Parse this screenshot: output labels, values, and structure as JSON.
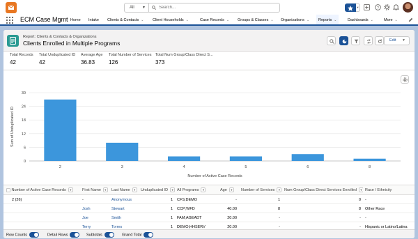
{
  "app": {
    "name": "ECM Case Mgmt",
    "search_scope": "All",
    "search_placeholder": "Search...",
    "nav": [
      {
        "label": "Home",
        "dropdown": false
      },
      {
        "label": "Intake",
        "dropdown": false
      },
      {
        "label": "Clients & Contacts",
        "dropdown": true
      },
      {
        "label": "Client Households",
        "dropdown": true
      },
      {
        "label": "Case Records",
        "dropdown": true
      },
      {
        "label": "Groups & Classes",
        "dropdown": true
      },
      {
        "label": "Organizations",
        "dropdown": true
      },
      {
        "label": "Reports",
        "dropdown": true,
        "active": true
      },
      {
        "label": "Dashboards",
        "dropdown": true
      },
      {
        "label": "More",
        "dropdown": true
      }
    ]
  },
  "report": {
    "eyebrow": "Report: Clients & Contacts & Organizations",
    "title": "Clients Enrolled in Multiple Programs",
    "edit_label": "Edit",
    "aggregates": [
      {
        "label": "Total Records",
        "value": "42"
      },
      {
        "label": "Total Unduplicated ID",
        "value": "42"
      },
      {
        "label": "Average Age",
        "value": "36.83"
      },
      {
        "label": "Total Number of Services",
        "value": "126"
      },
      {
        "label": "Total Num Group/Class Direct S...",
        "value": "373"
      }
    ]
  },
  "chart_data": {
    "type": "bar",
    "categories": [
      "2",
      "3",
      "4",
      "5",
      "6",
      "8"
    ],
    "values": [
      27,
      8,
      2,
      2,
      3,
      1
    ],
    "xlabel": "Number of Active Case Records",
    "ylabel": "Sum of Unduplicated ID",
    "ylim": [
      0,
      30
    ],
    "yticks": [
      "0",
      "6",
      "12",
      "18",
      "24",
      "30"
    ],
    "color": "#3c96dc",
    "grid": true
  },
  "table": {
    "columns": [
      "Number of Active Case Records",
      "First Name",
      "Last Name",
      "Unduplicated ID",
      "All Programs",
      "Age",
      "Number of Services",
      "Num Group/Class Direct Services Enrolled",
      "Race / Ethnicity"
    ],
    "rows": [
      {
        "group": "2 (26)",
        "first": "-",
        "last": "Anonymous",
        "uid": "1",
        "programs": "CFS;DEMO",
        "age": "-",
        "services": "1",
        "group_svc": "0",
        "race": "-"
      },
      {
        "group": "",
        "first": "Josh",
        "last": "Stewart",
        "uid": "1",
        "programs": "CCP;WFD",
        "age": "40.00",
        "services": "8",
        "group_svc": "8",
        "race": "Other Race"
      },
      {
        "group": "",
        "first": "Joe",
        "last": "Smith",
        "uid": "1",
        "programs": "FAM;AGEADT",
        "age": "20.00",
        "services": "-",
        "group_svc": "-",
        "race": "-"
      },
      {
        "group": "",
        "first": "Terry",
        "last": "Torres",
        "uid": "1",
        "programs": "DEMO;HHSERV",
        "age": "20.00",
        "services": "-",
        "group_svc": "-",
        "race": "Hispanic or Latino/Latina"
      }
    ]
  },
  "footer": {
    "toggles": [
      {
        "label": "Row Counts",
        "state": "on"
      },
      {
        "label": "Detail Rows",
        "state": "on"
      },
      {
        "label": "Subtotals",
        "state": "on"
      },
      {
        "label": "Grand Total",
        "state": "on"
      }
    ]
  }
}
